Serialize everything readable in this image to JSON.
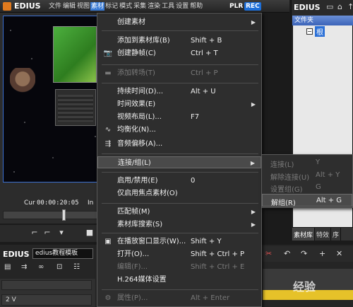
{
  "app": {
    "title": "EDIUS",
    "plr": "PLR",
    "rec": "REC"
  },
  "menubar": {
    "items": [
      "文件",
      "编辑",
      "视图",
      "素材",
      "标记",
      "模式",
      "采集",
      "渲染",
      "工具",
      "设置",
      "帮助"
    ],
    "active_index": 3
  },
  "monitor": {
    "cur_label": "Cur",
    "cur_value": "00:00:20:05",
    "in_label": "In"
  },
  "timeline": {
    "title": "EDIUS",
    "project_name": "edius教程模板",
    "track_label": "2 V"
  },
  "bin": {
    "title": "EDIUS",
    "folder_header": "文件夹",
    "root_label": "根",
    "root_toggle": "−",
    "tabs": [
      "素材库",
      "特效",
      "序"
    ]
  },
  "watermark": "经验",
  "context_menu": {
    "items": [
      {
        "label": "创建素材",
        "shortcut": "",
        "icon": "",
        "arrow": true,
        "disabled": false
      },
      {
        "label": "添加到素材库(B)",
        "shortcut": "Shift + B",
        "icon": "",
        "arrow": false,
        "disabled": false
      },
      {
        "label": "创建静帧(C)",
        "shortcut": "Ctrl + T",
        "icon": "camera-icon",
        "arrow": false,
        "disabled": false
      },
      {
        "label": "添加转场(T)",
        "shortcut": "Ctrl + P",
        "icon": "transition-icon",
        "arrow": false,
        "disabled": true
      },
      {
        "label": "持续时间(D)...",
        "shortcut": "Alt + U",
        "icon": "",
        "arrow": false,
        "disabled": false
      },
      {
        "label": "时间效果(E)",
        "shortcut": "",
        "icon": "",
        "arrow": true,
        "disabled": false
      },
      {
        "label": "视频布局(L)...",
        "shortcut": "F7",
        "icon": "",
        "arrow": false,
        "disabled": false
      },
      {
        "label": "均衡化(N)...",
        "shortcut": "",
        "icon": "waveform-icon",
        "arrow": false,
        "disabled": false
      },
      {
        "label": "音频偏移(A)...",
        "shortcut": "",
        "icon": "audio-offset-icon",
        "arrow": false,
        "disabled": false
      },
      {
        "label": "连接/组(L)",
        "shortcut": "",
        "icon": "",
        "arrow": true,
        "disabled": false
      },
      {
        "label": "启用/禁用(E)",
        "shortcut": "0",
        "icon": "",
        "arrow": false,
        "disabled": false
      },
      {
        "label": "仅启用焦点素材(O)",
        "shortcut": "",
        "icon": "",
        "arrow": false,
        "disabled": false
      },
      {
        "label": "匹配帧(M)",
        "shortcut": "",
        "icon": "",
        "arrow": true,
        "disabled": false
      },
      {
        "label": "素材库搜索(S)",
        "shortcut": "",
        "icon": "",
        "arrow": true,
        "disabled": false
      },
      {
        "label": "在播放窗口显示(W)...",
        "shortcut": "Shift + Y",
        "icon": "player-window-icon",
        "arrow": false,
        "disabled": false
      },
      {
        "label": "打开(O)...",
        "shortcut": "Shift + Ctrl + P",
        "icon": "",
        "arrow": false,
        "disabled": false
      },
      {
        "label": "编辑(F)...",
        "shortcut": "Shift + Ctrl + E",
        "icon": "",
        "arrow": false,
        "disabled": true
      },
      {
        "label": "H.264媒体设置",
        "shortcut": "",
        "icon": "",
        "arrow": false,
        "disabled": false
      },
      {
        "label": "属性(P)...",
        "shortcut": "Alt + Enter",
        "icon": "properties-icon",
        "arrow": false,
        "disabled": true
      }
    ]
  },
  "submenu": {
    "items": [
      {
        "label": "连接(L)",
        "shortcut": "Y",
        "disabled": true
      },
      {
        "label": "解除连接(U)",
        "shortcut": "Alt + Y",
        "disabled": true
      },
      {
        "label": "设置组(G)",
        "shortcut": "G",
        "disabled": true
      },
      {
        "label": "解组(R)",
        "shortcut": "Alt + G",
        "disabled": false
      }
    ]
  },
  "icons": {
    "camera": "📷",
    "transition": "▬",
    "waveform": "∿",
    "audio_offset": "⇶",
    "player_window": "▣",
    "properties": "⚙",
    "arrow": "▶"
  }
}
